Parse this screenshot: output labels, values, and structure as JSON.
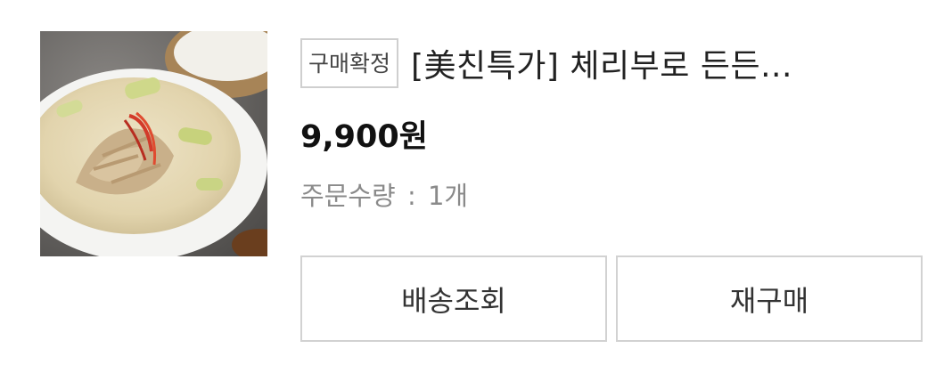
{
  "order_item": {
    "status_badge": "구매확정",
    "title": "[美친특가] 체리부로 든든...",
    "price": "9,900원",
    "quantity_label": "주문수량",
    "quantity_separator": ":",
    "quantity_value": "1개",
    "thumbnail_icon": "chicken-soup-photo"
  },
  "actions": {
    "track_delivery_label": "배송조회",
    "reorder_label": "재구매"
  },
  "colors": {
    "border": "#d2d2d2",
    "price_text": "#111111",
    "muted_text": "#8a8a8a"
  }
}
